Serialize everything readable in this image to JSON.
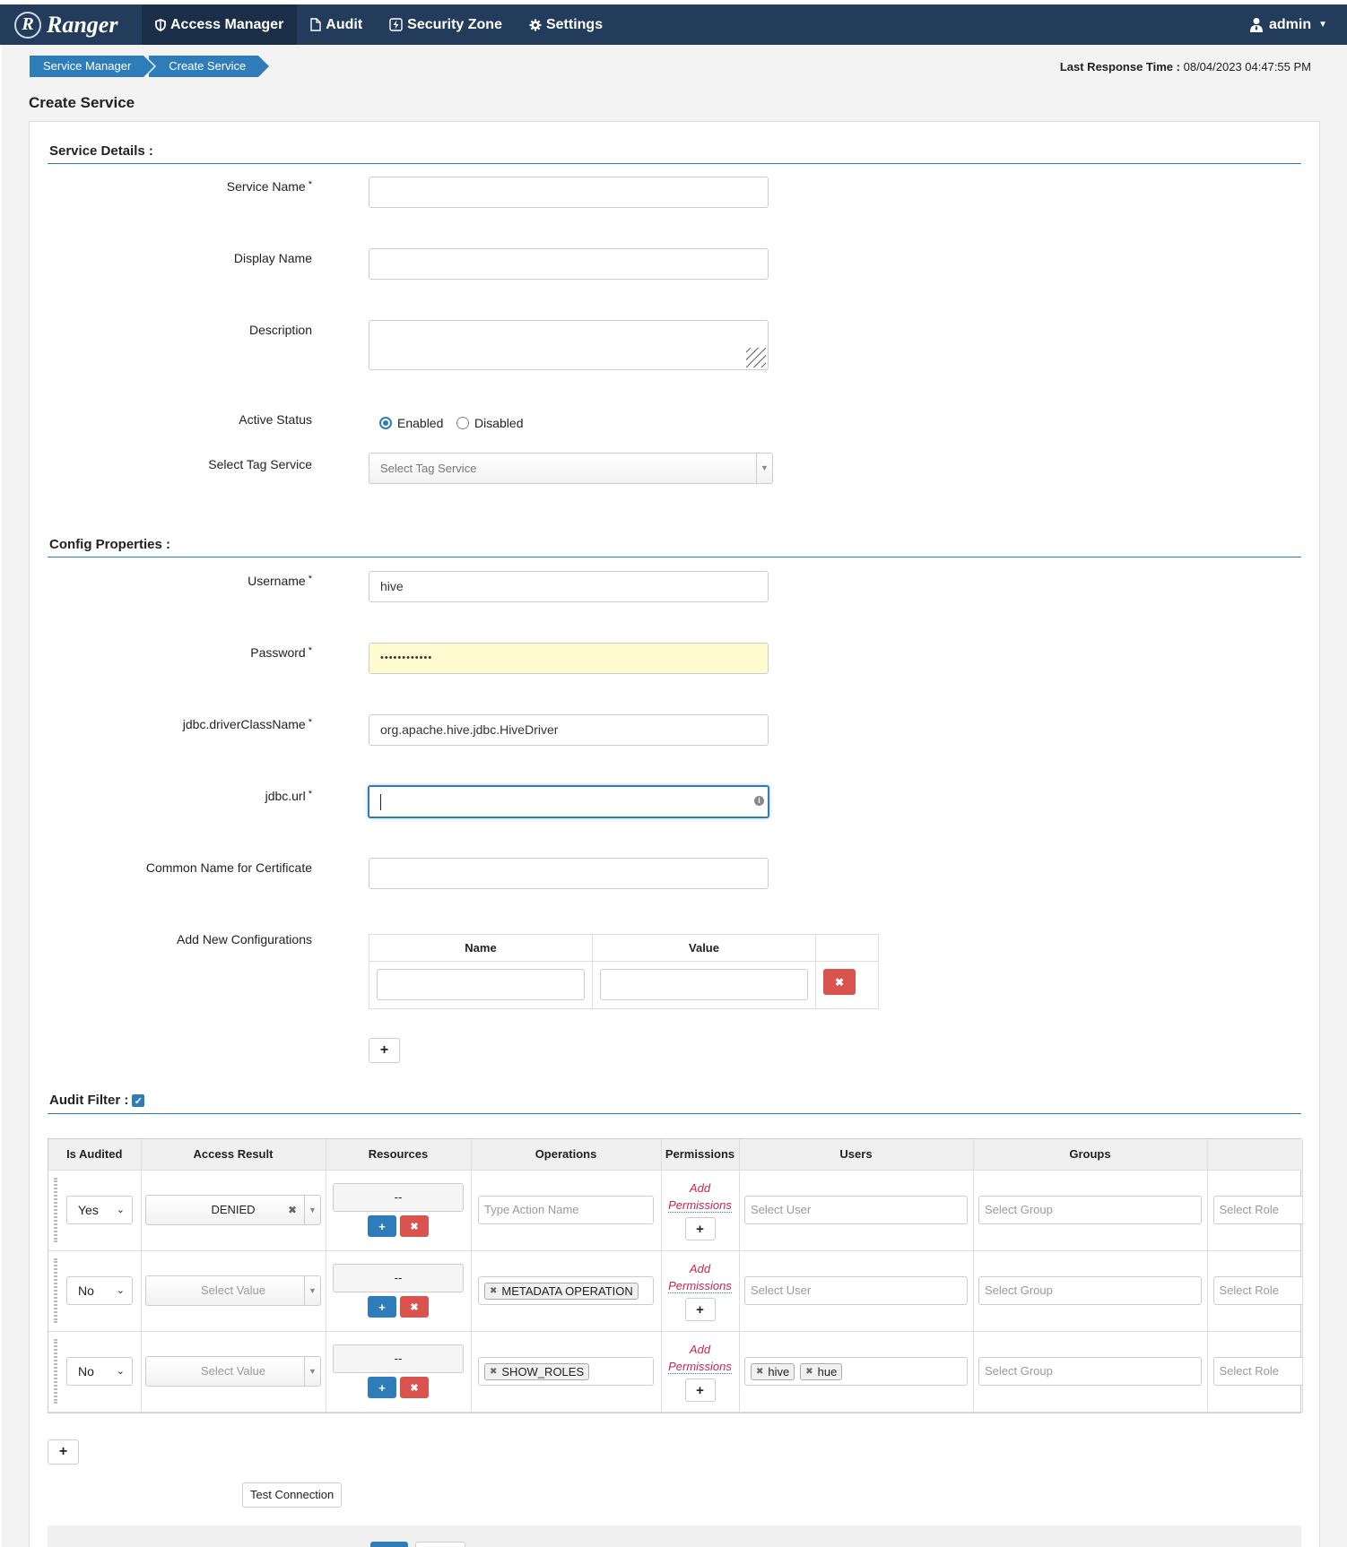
{
  "nav": {
    "brand": "Ranger",
    "brand_logo_letter": "R",
    "items": [
      {
        "label": "Access Manager",
        "icon": "shield-icon"
      },
      {
        "label": "Audit",
        "icon": "file-icon"
      },
      {
        "label": "Security Zone",
        "icon": "bolt-icon"
      },
      {
        "label": "Settings",
        "icon": "gear-icon"
      }
    ],
    "user": "admin"
  },
  "breadcrumb": [
    "Service Manager",
    "Create Service"
  ],
  "last_response": {
    "label": "Last Response Time :",
    "value": "08/04/2023 04:47:55 PM"
  },
  "page_title": "Create Service",
  "service_details": {
    "heading": "Service Details :",
    "service_name": {
      "label": "Service Name",
      "required": "*",
      "value": ""
    },
    "display_name": {
      "label": "Display Name",
      "value": ""
    },
    "description": {
      "label": "Description",
      "value": ""
    },
    "active_status": {
      "label": "Active Status",
      "options": [
        "Enabled",
        "Disabled"
      ],
      "selected": "Enabled"
    },
    "tag_service": {
      "label": "Select Tag Service",
      "placeholder": "Select Tag Service"
    }
  },
  "config": {
    "heading": "Config Properties :",
    "username": {
      "label": "Username",
      "required": "*",
      "value": "hive"
    },
    "password": {
      "label": "Password",
      "required": "*",
      "value": "••••••••••••"
    },
    "driver": {
      "label": "jdbc.driverClassName",
      "required": "*",
      "value": "org.apache.hive.jdbc.HiveDriver"
    },
    "url": {
      "label": "jdbc.url",
      "required": "*",
      "value": ""
    },
    "cn": {
      "label": "Common Name for Certificate",
      "value": ""
    },
    "new_configs": {
      "label": "Add New Configurations",
      "col_name": "Name",
      "col_value": "Value"
    }
  },
  "audit_filter": {
    "heading": "Audit Filter :",
    "checked": true,
    "columns": [
      "Is Audited",
      "Access Result",
      "Resources",
      "Operations",
      "Permissions",
      "Users",
      "Groups",
      ""
    ],
    "rows": [
      {
        "is_audited": "Yes",
        "access_result": "DENIED",
        "resources": "--",
        "operations_placeholder": "Type Action Name",
        "operations_tags": [],
        "permissions": [
          "Add",
          "Permissions"
        ],
        "users_placeholder": "Select User",
        "users_tags": [],
        "groups": "Select Group",
        "roles": "Select Role"
      },
      {
        "is_audited": "No",
        "access_result": "Select Value",
        "resources": "--",
        "operations_placeholder": "",
        "operations_tags": [
          "METADATA OPERATION"
        ],
        "permissions": [
          "Add",
          "Permissions"
        ],
        "users_placeholder": "Select User",
        "users_tags": [],
        "groups": "Select Group",
        "roles": "Select Role"
      },
      {
        "is_audited": "No",
        "access_result": "Select Value",
        "resources": "--",
        "operations_placeholder": "",
        "operations_tags": [
          "SHOW_ROLES"
        ],
        "permissions": [
          "Add",
          "Permissions"
        ],
        "users_placeholder": "",
        "users_tags": [
          "hive",
          "hue"
        ],
        "groups": "Select Group",
        "roles": "Select Role"
      }
    ]
  },
  "buttons": {
    "test_connection": "Test Connection"
  }
}
